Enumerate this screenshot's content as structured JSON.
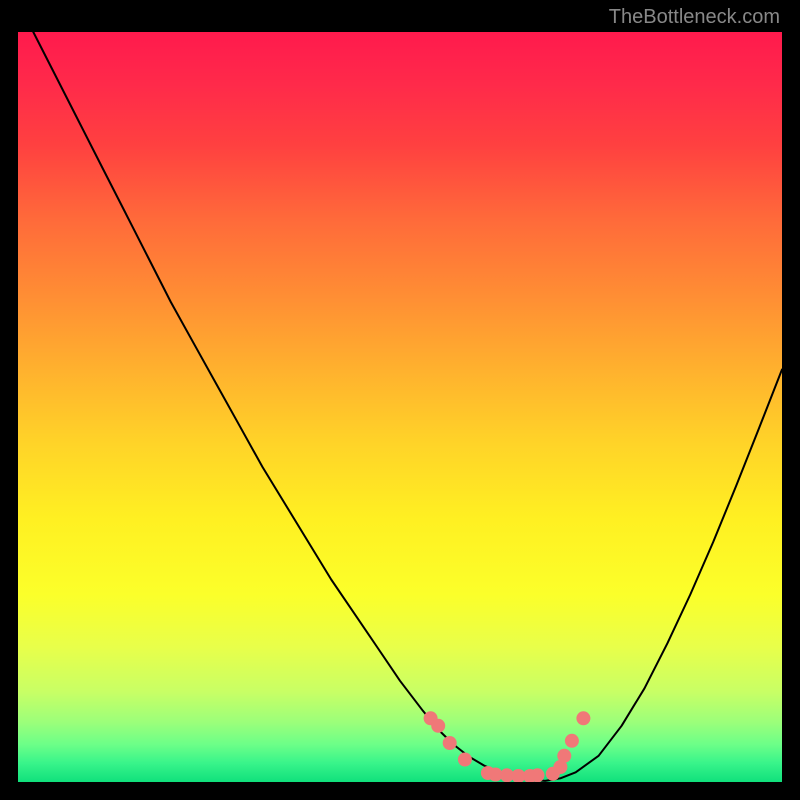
{
  "watermark": "TheBottleneck.com",
  "colors": {
    "outer_bg": "#000000",
    "curve": "#000000",
    "dots": "#f07878"
  },
  "chart_data": {
    "type": "line",
    "title": "",
    "xlabel": "",
    "ylabel": "",
    "xlim": [
      0,
      100
    ],
    "ylim": [
      0,
      100
    ],
    "x": [
      2,
      5,
      8,
      11,
      14,
      17,
      20,
      23,
      26,
      29,
      32,
      35,
      38,
      41,
      44,
      47,
      50,
      53,
      55,
      57,
      59,
      61,
      63,
      65,
      67,
      69,
      71,
      73,
      76,
      79,
      82,
      85,
      88,
      91,
      94,
      97,
      100
    ],
    "values": [
      100,
      94,
      88,
      82,
      76,
      70,
      64,
      58.5,
      53,
      47.5,
      42,
      37,
      32,
      27,
      22.5,
      18,
      13.5,
      9.5,
      7,
      5,
      3.4,
      2.2,
      1.3,
      0.6,
      0.3,
      0.15,
      0.5,
      1.3,
      3.5,
      7.5,
      12.5,
      18.5,
      25,
      32,
      39.5,
      47.2,
      55
    ],
    "flat_region": {
      "x_start": 55,
      "x_end": 73
    },
    "dots": [
      {
        "x": 54,
        "y": 8.5
      },
      {
        "x": 55,
        "y": 7.5
      },
      {
        "x": 56.5,
        "y": 5.2
      },
      {
        "x": 58.5,
        "y": 3.0
      },
      {
        "x": 61.5,
        "y": 1.2
      },
      {
        "x": 62.5,
        "y": 1.0
      },
      {
        "x": 64,
        "y": 0.9
      },
      {
        "x": 65.5,
        "y": 0.8
      },
      {
        "x": 67,
        "y": 0.8
      },
      {
        "x": 68,
        "y": 0.9
      },
      {
        "x": 70,
        "y": 1.1
      },
      {
        "x": 71,
        "y": 2.0
      },
      {
        "x": 71.5,
        "y": 3.5
      },
      {
        "x": 72.5,
        "y": 5.5
      },
      {
        "x": 74,
        "y": 8.5
      }
    ],
    "gradient_stops": [
      {
        "offset": 0.0,
        "color": "#ff1a4d"
      },
      {
        "offset": 0.07,
        "color": "#ff2a4a"
      },
      {
        "offset": 0.15,
        "color": "#ff4040"
      },
      {
        "offset": 0.25,
        "color": "#ff6a3a"
      },
      {
        "offset": 0.35,
        "color": "#ff8d34"
      },
      {
        "offset": 0.45,
        "color": "#ffb12e"
      },
      {
        "offset": 0.55,
        "color": "#ffd428"
      },
      {
        "offset": 0.65,
        "color": "#fff022"
      },
      {
        "offset": 0.75,
        "color": "#fbff2a"
      },
      {
        "offset": 0.82,
        "color": "#e8ff4a"
      },
      {
        "offset": 0.88,
        "color": "#c8ff65"
      },
      {
        "offset": 0.92,
        "color": "#9cff7a"
      },
      {
        "offset": 0.95,
        "color": "#6cff88"
      },
      {
        "offset": 0.975,
        "color": "#38f48a"
      },
      {
        "offset": 1.0,
        "color": "#10e07c"
      }
    ]
  }
}
